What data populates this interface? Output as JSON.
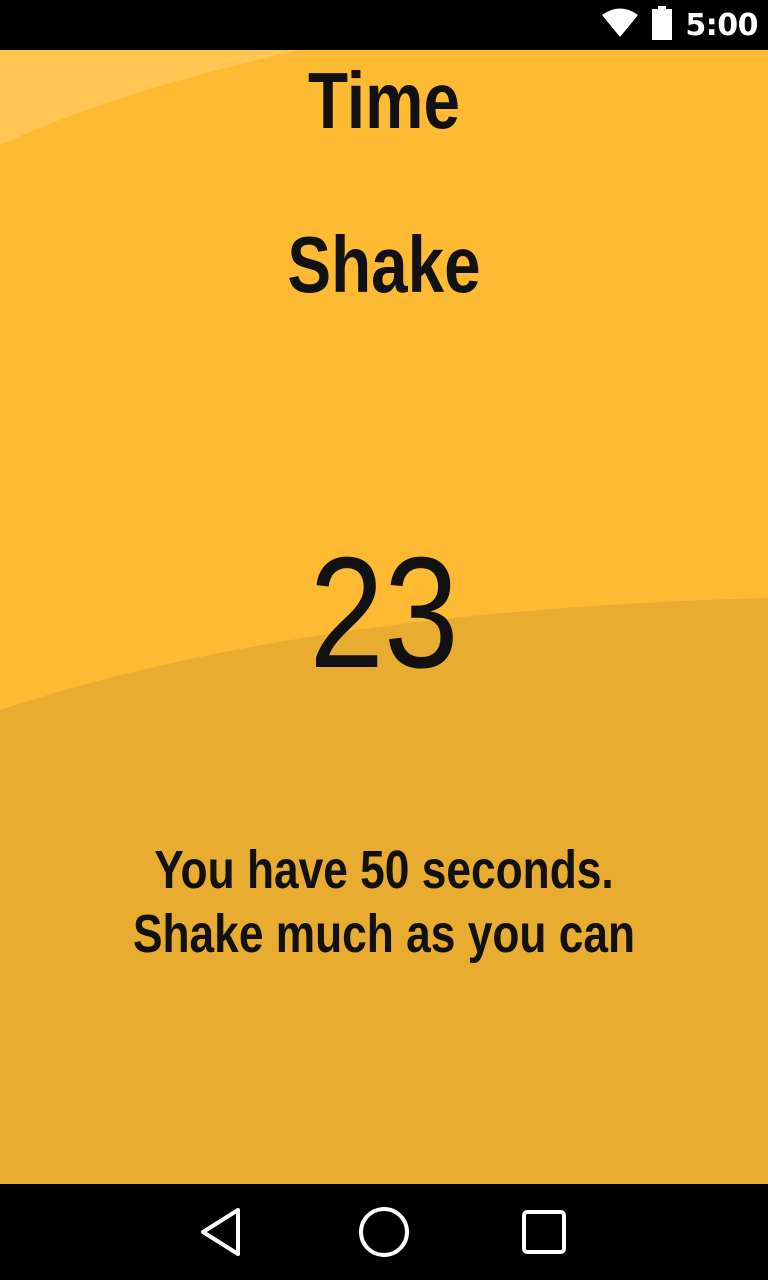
{
  "status_bar": {
    "time": "5:00",
    "icons": [
      "wifi-icon",
      "battery-icon"
    ]
  },
  "app": {
    "title_line1": "Time",
    "title_line2": "Shake",
    "counter": "23",
    "instructions_line1": "You have 50 seconds.",
    "instructions_line2": "Shake much as you can"
  },
  "colors": {
    "background": "#FFBA33",
    "background_lower": "#E8AC30",
    "background_highlight": "#FFC654",
    "text": "#111111"
  },
  "nav_bar": {
    "buttons": [
      "back-icon",
      "home-icon",
      "recents-icon"
    ]
  }
}
